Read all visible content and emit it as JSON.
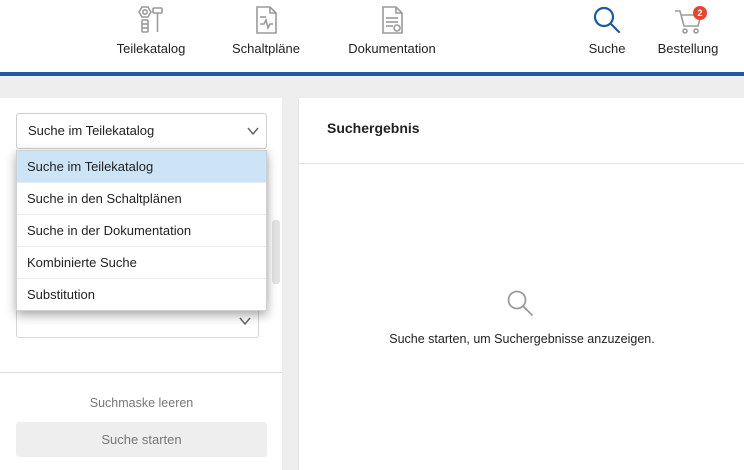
{
  "nav": {
    "items": [
      {
        "label": "Teilekatalog",
        "icon": "parts-catalog-icon"
      },
      {
        "label": "Schaltpläne",
        "icon": "circuit-diagram-icon"
      },
      {
        "label": "Dokumentation",
        "icon": "documentation-icon"
      },
      {
        "label": "Suche",
        "icon": "search-icon"
      },
      {
        "label": "Bestellung",
        "icon": "cart-icon",
        "badge": "2"
      }
    ],
    "accent_color": "#1c5a9e",
    "badge_color": "#e8432f"
  },
  "search_panel": {
    "scope_select": {
      "value": "Suche im Teilekatalog",
      "options": [
        "Suche im Teilekatalog",
        "Suche in den Schaltplänen",
        "Suche in der Dokumentation",
        "Kombinierte Suche",
        "Substitution"
      ],
      "selected_index": 0
    },
    "clear_label": "Suchmaske leeren",
    "start_label": "Suche starten"
  },
  "results": {
    "title": "Suchergebnis",
    "empty_message": "Suche starten, um Suchergebnisse anzuzeigen."
  }
}
